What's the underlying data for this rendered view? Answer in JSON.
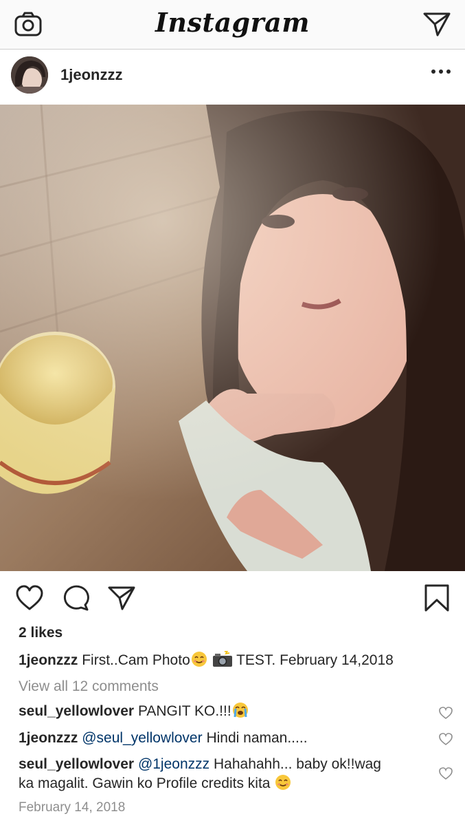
{
  "header": {
    "logo_text": "Instagram",
    "camera_icon": "camera-icon",
    "direct_icon": "paper-plane-icon"
  },
  "post": {
    "username": "1jeonzzz",
    "more_icon": "ellipsis-icon"
  },
  "actions": {
    "like_icon": "heart-icon",
    "comment_icon": "comment-icon",
    "share_icon": "paper-plane-icon",
    "save_icon": "bookmark-icon"
  },
  "likes_text": "2 likes",
  "caption": {
    "username": "1jeonzzz",
    "text_a": "First..Cam Photo",
    "text_b": "TEST. February 14,2018"
  },
  "view_all_comments": "View all 12 comments",
  "comments": [
    {
      "username": "seul_yellowlover",
      "text": "PANGIT KO.!!!"
    },
    {
      "username": "1jeonzzz",
      "mention": "@seul_yellowlover",
      "text": "Hindi naman....."
    },
    {
      "username": "seul_yellowlover",
      "mention": "@1jeonzzz",
      "text": "Hahahahh... baby ok!!wag",
      "text_line2": "ka magalit. Gawin ko Profile credits kita"
    }
  ],
  "post_date": "February 14, 2018"
}
